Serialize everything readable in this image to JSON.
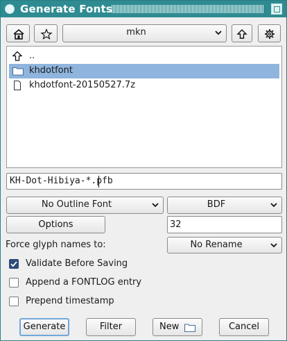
{
  "window": {
    "title": "Generate Fonts"
  },
  "toolbar": {
    "home_icon": "home-icon",
    "bookmark_icon": "star-icon",
    "directory": "mkn",
    "up_icon": "arrow-up-icon",
    "settings_icon": "gear-icon"
  },
  "files": [
    {
      "name": "..",
      "icon": "up-arrow-icon",
      "selected": false
    },
    {
      "name": "khdotfont",
      "icon": "folder-icon",
      "selected": true
    },
    {
      "name": "khdotfont-20150527.7z",
      "icon": "file-icon",
      "selected": false
    }
  ],
  "filename": {
    "value": "KH-Dot-Hibiya-*.pfb"
  },
  "outline_format": {
    "value": "No Outline Font"
  },
  "bitmap_format": {
    "value": "BDF"
  },
  "options_button": "Options",
  "bitmap_sizes": {
    "value": "32"
  },
  "glyph_names": {
    "label": "Force glyph names to:",
    "value": "No Rename"
  },
  "checkboxes": [
    {
      "label": "Validate Before Saving",
      "checked": true
    },
    {
      "label": "Append a FONTLOG entry",
      "checked": false
    },
    {
      "label": "Prepend timestamp",
      "checked": false
    }
  ],
  "buttons": {
    "generate": "Generate",
    "filter": "Filter",
    "new": "New",
    "cancel": "Cancel"
  },
  "colors": {
    "titlebar": "#2e8b91",
    "selection": "#8fb5de",
    "checkbox_checked": "#2c4d7a"
  }
}
